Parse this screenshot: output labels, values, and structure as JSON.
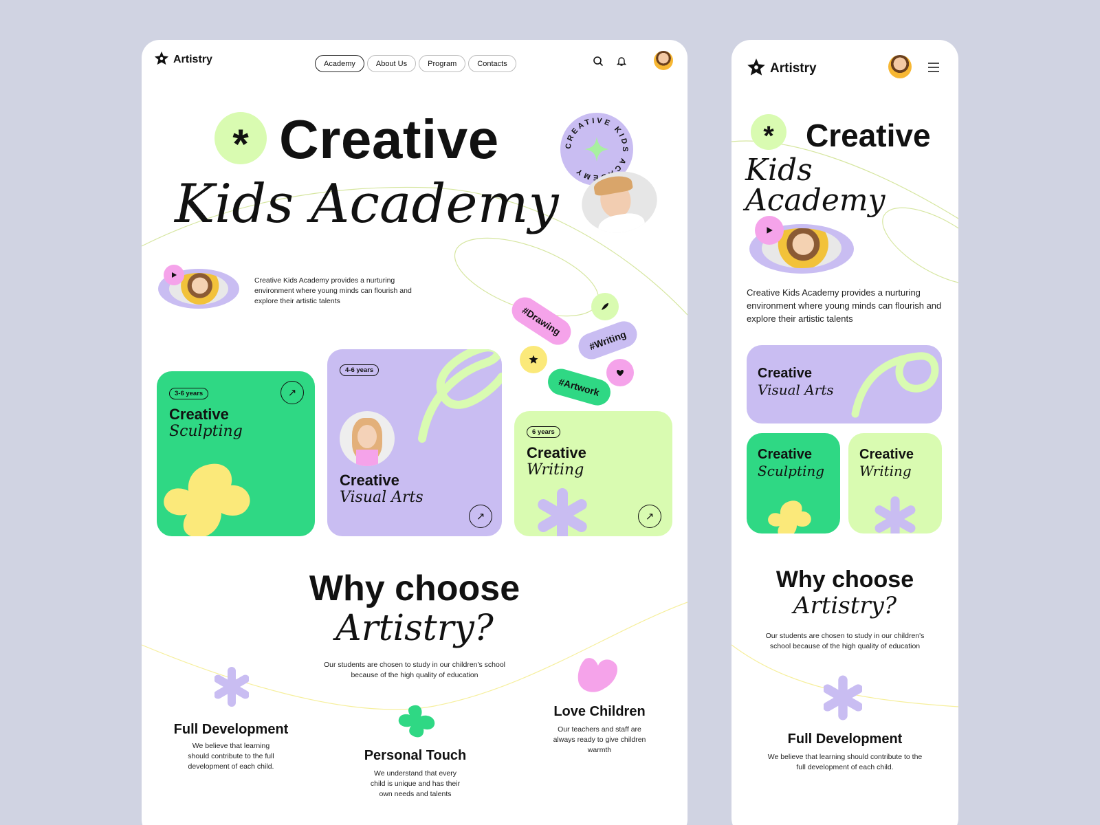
{
  "brand": {
    "name": "Artistry"
  },
  "nav": {
    "items": [
      "Academy",
      "About Us",
      "Program",
      "Contacts"
    ]
  },
  "hero": {
    "title_line1": "Creative",
    "title_line2": "Kids Academy",
    "badge_ring_text": "CREATIVE KIDS ACADEMY",
    "description": "Creative Kids Academy provides a nurturing environment where young minds can flourish and explore their artistic talents"
  },
  "tags": [
    "#Drawing",
    "#Writing",
    "#Artwork"
  ],
  "programs": [
    {
      "age": "3-6 years",
      "title": "Creative",
      "subtitle": "Sculpting"
    },
    {
      "age": "4-6 years",
      "title": "Creative",
      "subtitle": "Visual Arts"
    },
    {
      "age": "6 years",
      "title": "Creative",
      "subtitle": "Writing"
    }
  ],
  "why": {
    "line1": "Why choose",
    "line2": "Artistry?",
    "text": "Our students are chosen to study in our children's school because of the high quality of education"
  },
  "features": [
    {
      "title": "Full Development",
      "text": "We believe that learning should contribute to the full development of each child."
    },
    {
      "title": "Personal Touch",
      "text": "We understand that every child is unique and has their own needs and talents"
    },
    {
      "title": "Love Children",
      "text": "Our teachers and staff are always ready to give children warmth"
    }
  ],
  "icons": {
    "logo": "star-logo-icon",
    "search": "search-icon",
    "bell": "bell-icon",
    "menu": "hamburger-menu-icon",
    "play": "play-icon",
    "arrow": "arrow-up-right-icon"
  },
  "colors": {
    "background": "#d0d3e2",
    "green": "#2fd884",
    "lavender": "#c9bdf2",
    "lime": "#d9fbb1",
    "pink": "#f5a3ea",
    "yellow": "#fbe97a"
  }
}
